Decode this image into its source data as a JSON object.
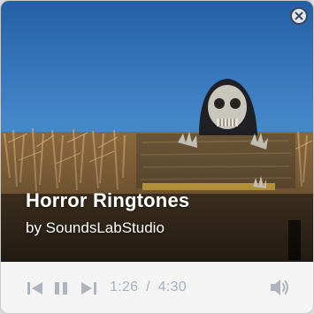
{
  "player": {
    "title": "Horror Ringtones",
    "artist": "by SoundsLabStudio",
    "current_time": "1:26",
    "separator": "/",
    "duration": "4:30"
  },
  "icons": {
    "close": "close-icon",
    "previous": "skip-previous-icon",
    "pause": "pause-icon",
    "next": "skip-next-icon",
    "volume": "volume-icon"
  },
  "colors": {
    "sky": "#2f6fb0",
    "icon": "#aeb4be",
    "time_text": "#a9b0bb",
    "close_border": "#3d4654"
  }
}
